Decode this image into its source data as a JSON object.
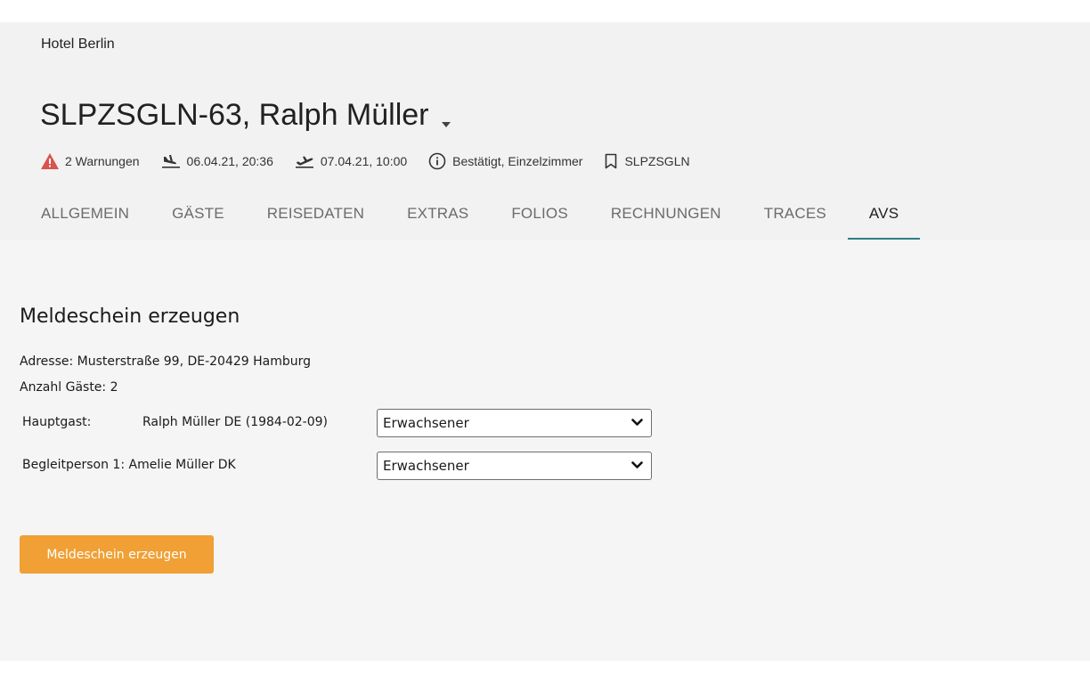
{
  "header": {
    "hotel_name": "Hotel Berlin",
    "booking_title": "SLPZSGLN-63, Ralph Müller",
    "meta": {
      "warnings": "2 Warnungen",
      "arrival": "06.04.21, 20:36",
      "departure": "07.04.21, 10:00",
      "status": "Bestätigt, Einzelzimmer",
      "booking_code": "SLPZSGLN"
    }
  },
  "tabs": [
    {
      "label": "ALLGEMEIN"
    },
    {
      "label": "GÄSTE"
    },
    {
      "label": "REISEDATEN"
    },
    {
      "label": "EXTRAS"
    },
    {
      "label": "FOLIOS"
    },
    {
      "label": "RECHNUNGEN"
    },
    {
      "label": "TRACES"
    },
    {
      "label": "AVS",
      "active": true
    }
  ],
  "main": {
    "section_title": "Meldeschein erzeugen",
    "address": "Adresse: Musterstraße 99, DE-20429 Hamburg",
    "guest_count": "Anzahl Gäste: 2",
    "guests": [
      {
        "label": "Hauptgast:",
        "name": "Ralph  Müller DE (1984-02-09)",
        "type": "Erwachsener"
      },
      {
        "label": "Begleitperson 1: Amelie Müller DK",
        "name": "",
        "type": "Erwachsener"
      }
    ],
    "create_button": "Meldeschein erzeugen"
  },
  "colors": {
    "accent": "#2e7e88",
    "button": "#f0a035",
    "warning": "#d9534f",
    "background": "#f5f5f5"
  },
  "icons": {
    "warning": "warning-triangle-icon",
    "arrival": "flight-land-icon",
    "departure": "flight-takeoff-icon",
    "status": "info-icon",
    "booking": "bookmark-icon",
    "title_menu": "caret-down-icon"
  }
}
